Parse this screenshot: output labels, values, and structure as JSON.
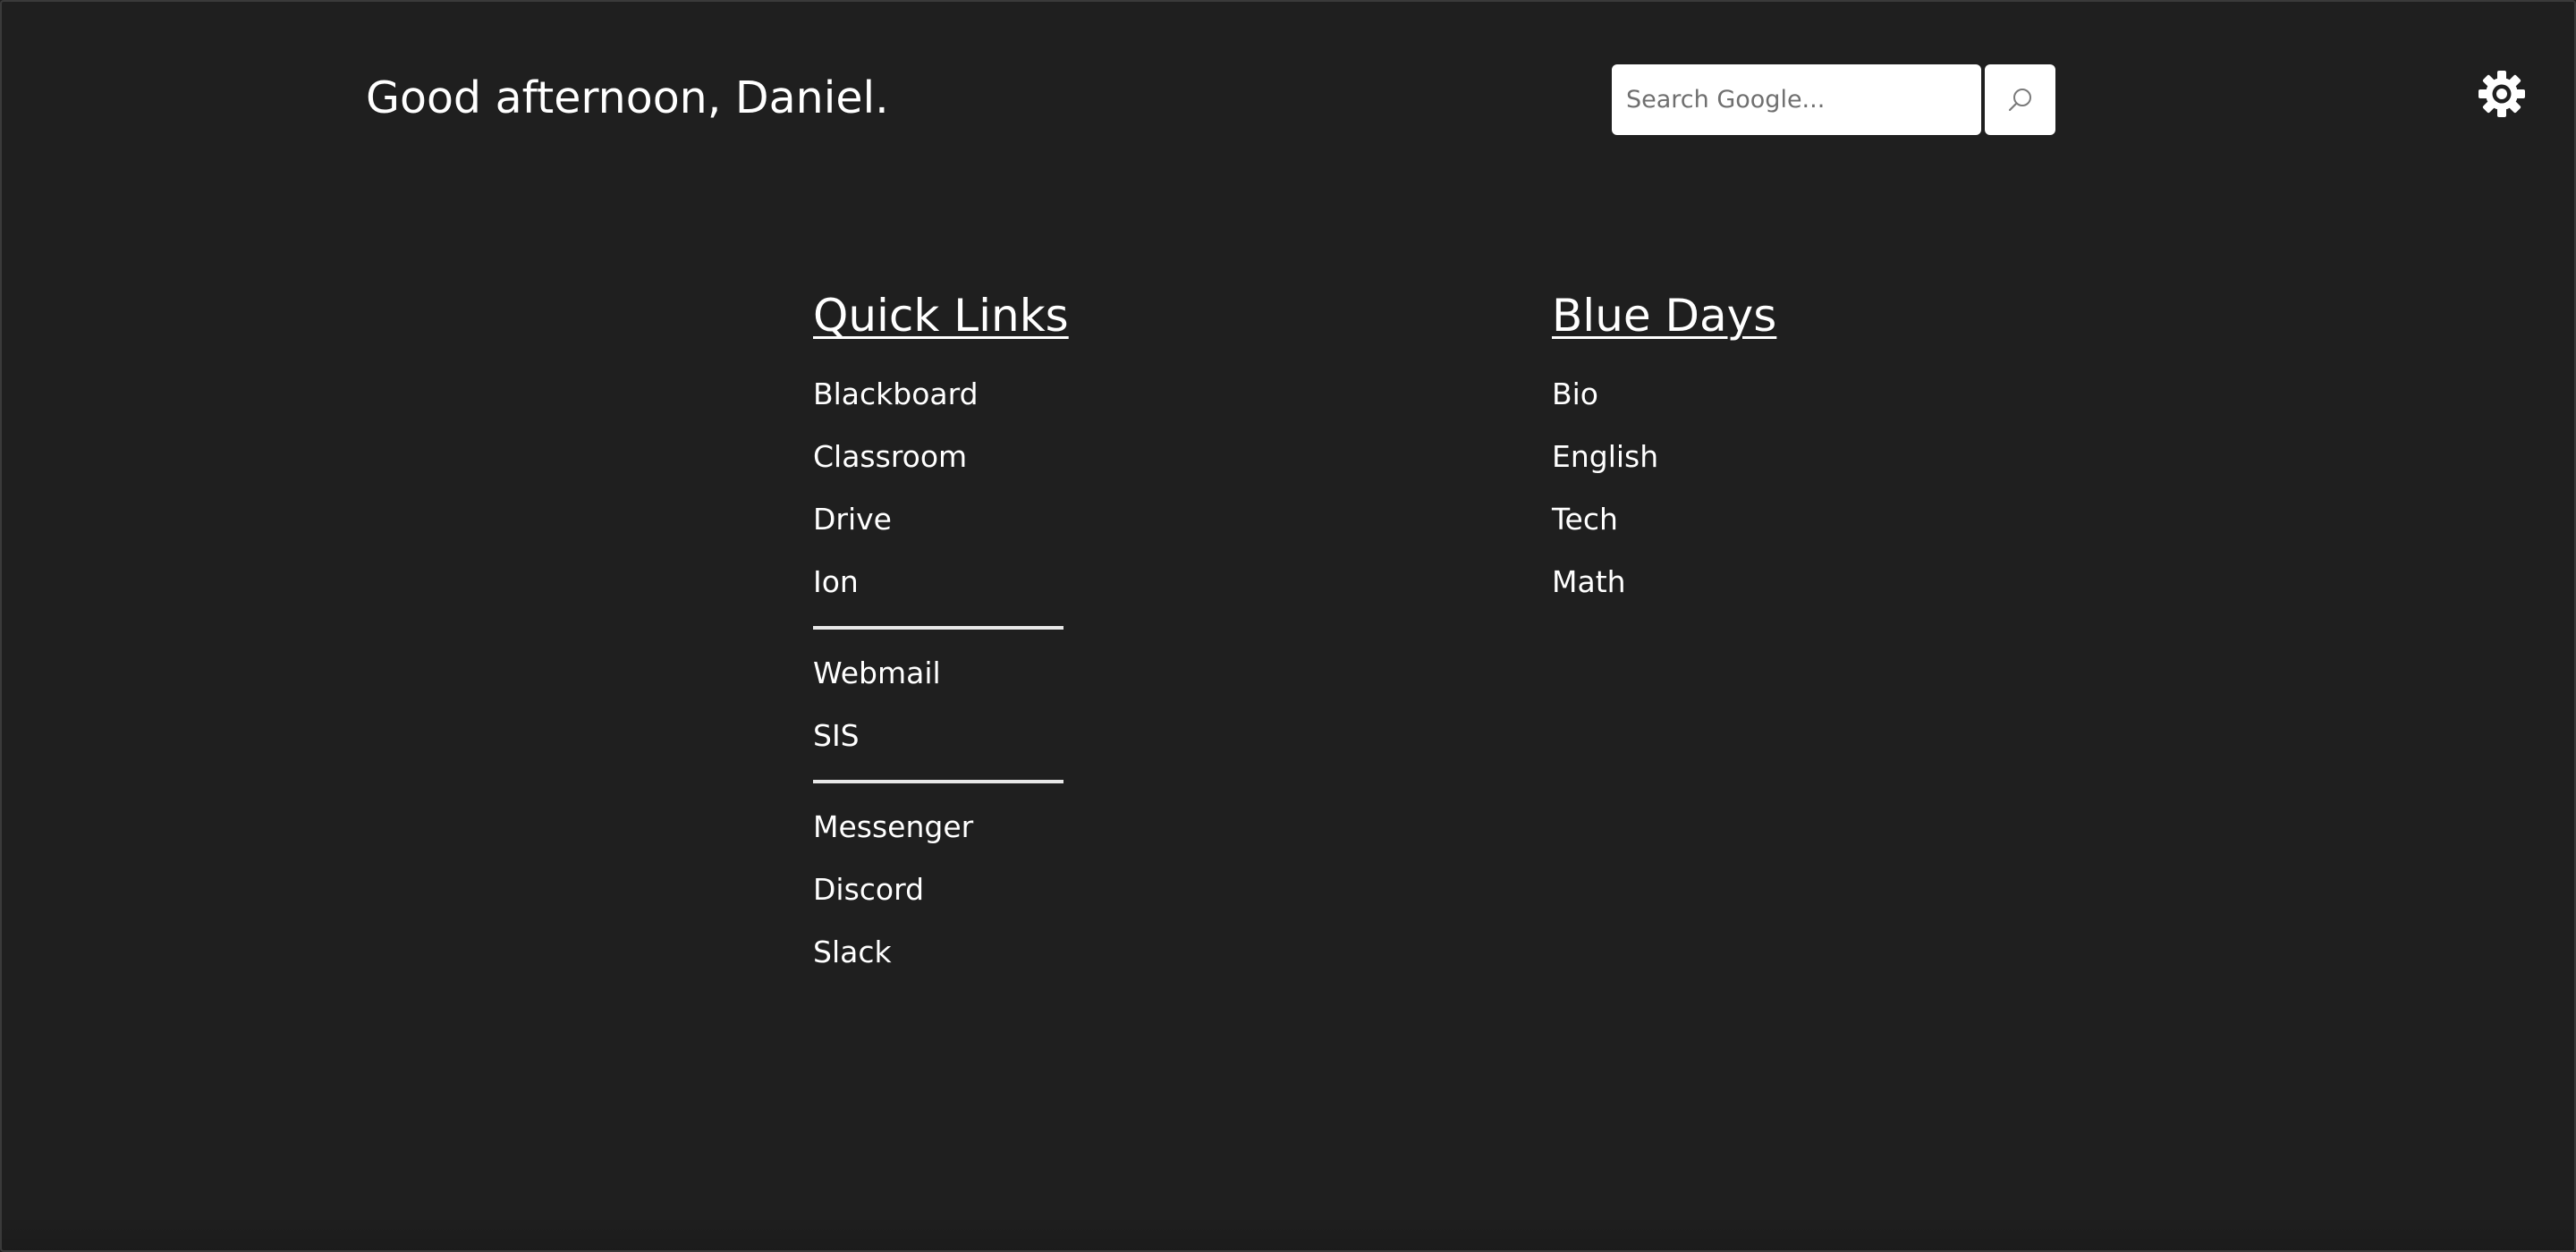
{
  "greeting": "Good afternoon, Daniel.",
  "search": {
    "placeholder": "Search Google...",
    "button_icon": "search-icon"
  },
  "settings": {
    "icon": "gear-icon"
  },
  "quick_links": {
    "title": "Quick Links",
    "groups": [
      [
        "Blackboard",
        "Classroom",
        "Drive",
        "Ion"
      ],
      [
        "Webmail",
        "SIS"
      ],
      [
        "Messenger",
        "Discord",
        "Slack"
      ]
    ]
  },
  "blue_days": {
    "title": "Blue Days",
    "items": [
      "Bio",
      "English",
      "Tech",
      "Math"
    ]
  },
  "colors": {
    "background": "#1f1f1f",
    "text": "#ffffff",
    "divider": "#e8e8e8"
  }
}
